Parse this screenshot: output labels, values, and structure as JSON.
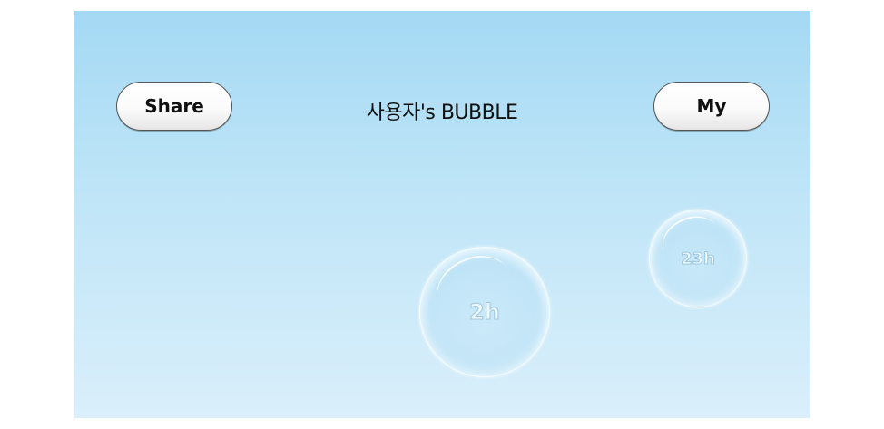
{
  "header": {
    "share_label": "Share",
    "title": "사용자's BUBBLE",
    "my_label": "My"
  },
  "bubbles": [
    {
      "label": "2h"
    },
    {
      "label": "23h"
    }
  ],
  "colors": {
    "background_top": "#a4d9f4",
    "background_bottom": "#daeffb",
    "button_fill": "#ffffff",
    "button_border": "#555555",
    "text": "#111111"
  }
}
